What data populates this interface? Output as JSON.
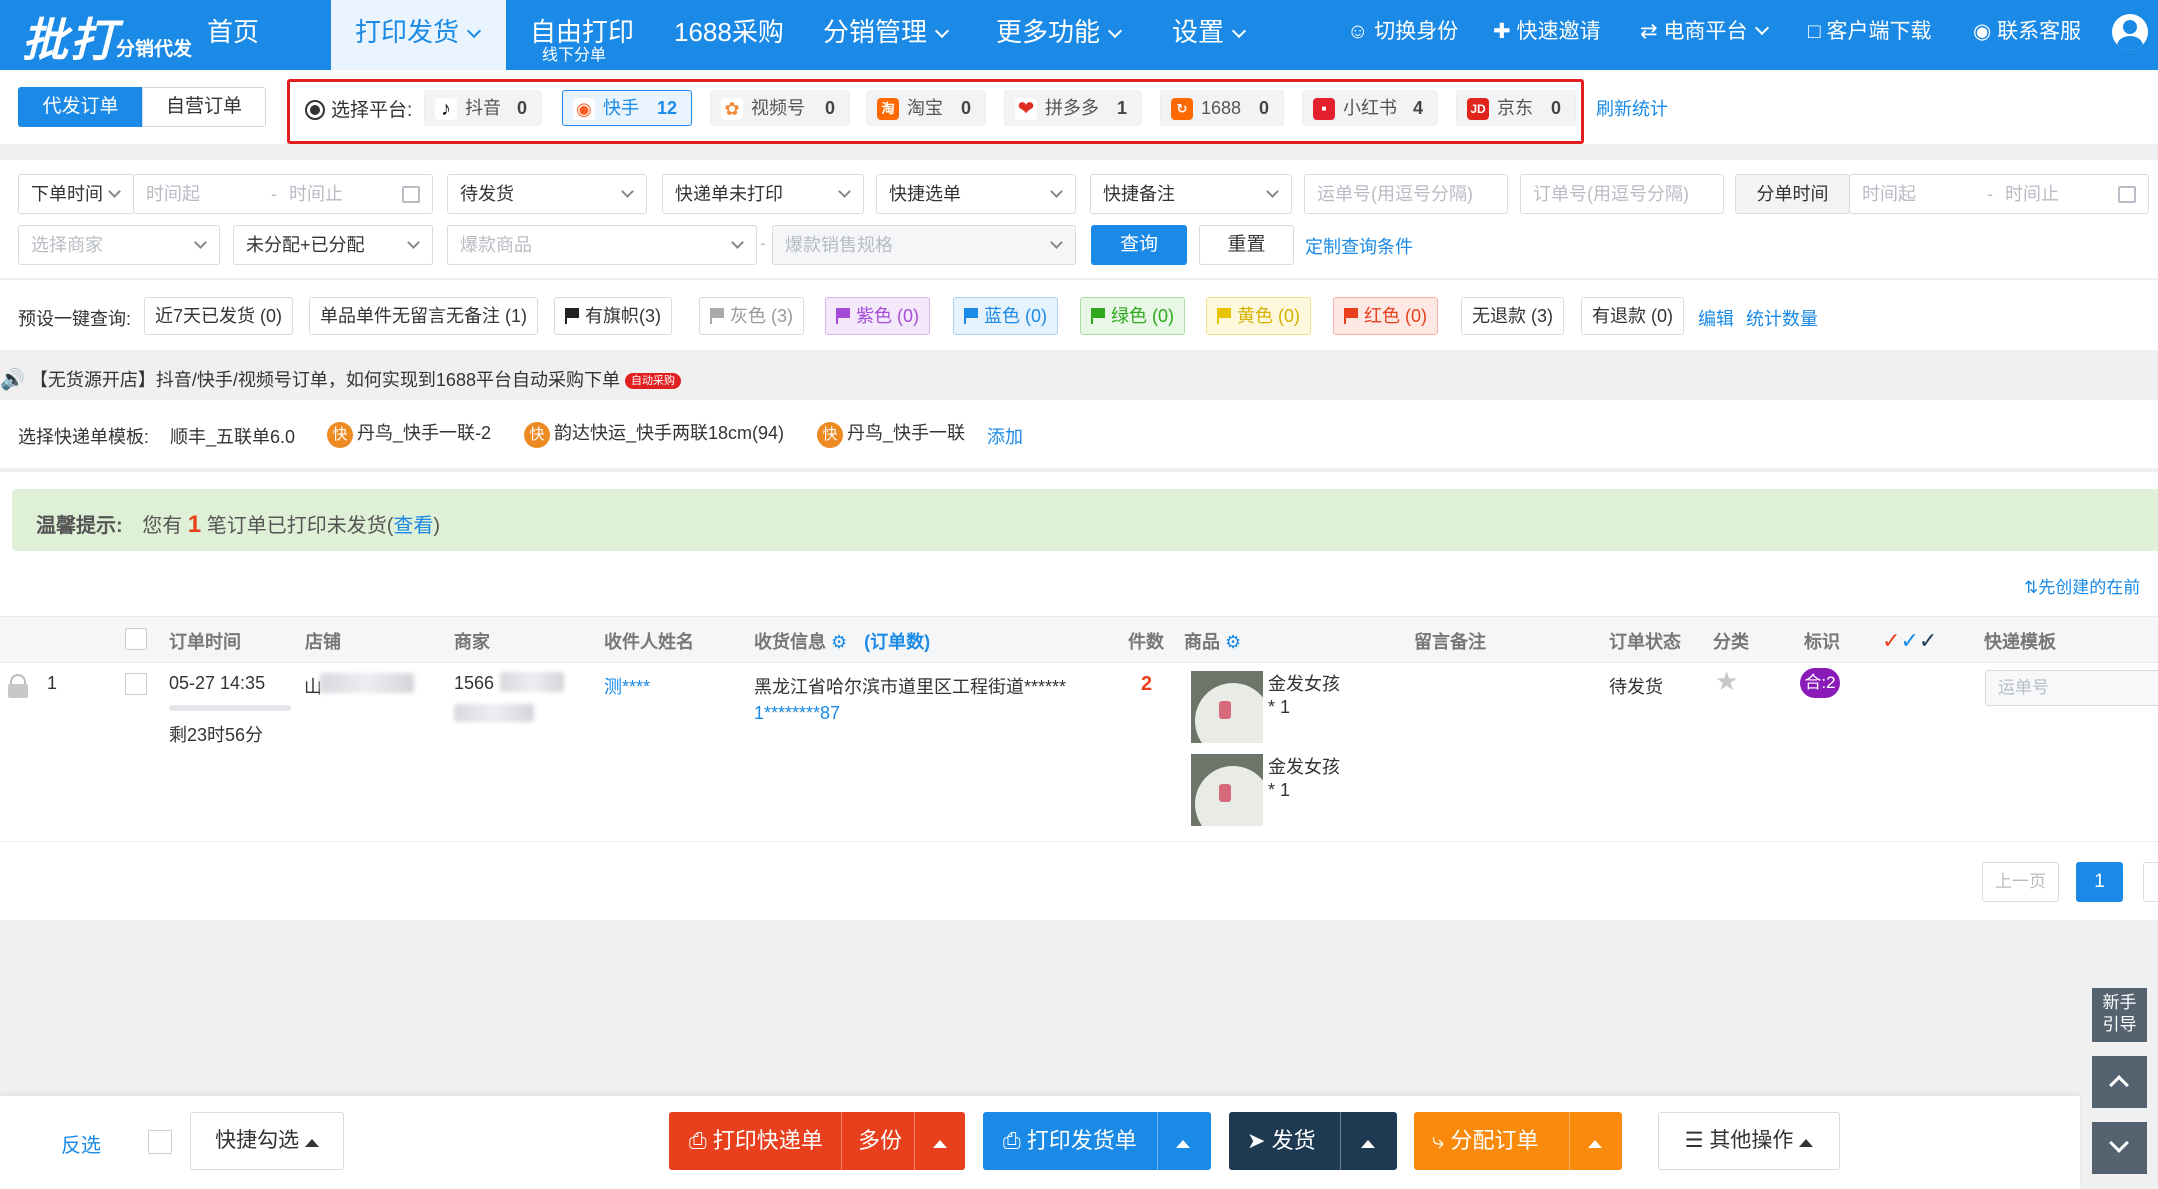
{
  "brand": {
    "logo_main": "批打",
    "logo_sub": "分销代发"
  },
  "nav": {
    "home": "首页",
    "print_ship": "打印发货",
    "free_print": "自由打印",
    "free_print_sub": "线下分单",
    "purchase_1688": "1688采购",
    "distribution": "分销管理",
    "more": "更多功能",
    "settings": "设置"
  },
  "nav_right": {
    "switch_identity": "切换身份",
    "quick_invite": "快速邀请",
    "ecommerce": "电商平台",
    "client_download": "客户端下载",
    "contact_support": "联系客服"
  },
  "order_tabs": {
    "proxy": "代发订单",
    "self": "自营订单"
  },
  "platform": {
    "label": "选择平台:",
    "items": [
      {
        "name": "抖音",
        "count": "0",
        "icon": "douyin-icon",
        "color": "#111111"
      },
      {
        "name": "快手",
        "count": "12",
        "icon": "kuaishou-icon",
        "color": "#ff5a1f"
      },
      {
        "name": "视频号",
        "count": "0",
        "icon": "shipinhao-icon",
        "color": "#f08a3c"
      },
      {
        "name": "淘宝",
        "count": "0",
        "icon": "taobao-icon",
        "color": "#ff6a00"
      },
      {
        "name": "拼多多",
        "count": "1",
        "icon": "pinduoduo-icon",
        "color": "#e02e24"
      },
      {
        "name": "1688",
        "count": "0",
        "icon": "1688-icon",
        "color": "#ff6a00"
      },
      {
        "name": "小红书",
        "count": "4",
        "icon": "xiaohongshu-icon",
        "color": "#e4202c"
      },
      {
        "name": "京东",
        "count": "0",
        "icon": "jd-icon",
        "color": "#e1251b"
      }
    ],
    "refresh": "刷新统计"
  },
  "filters": {
    "order_time": "下单时间",
    "time_start": "时间起",
    "time_end": "时间止",
    "status": "待发货",
    "express_print": "快递单未打印",
    "quick_select": "快捷选单",
    "quick_remark": "快捷备注",
    "waybill_ph": "运单号(用逗号分隔)",
    "order_no_ph": "订单号(用逗号分隔)",
    "split_time": "分单时间",
    "split_start": "时间起",
    "split_end": "时间止",
    "merchant_ph": "选择商家",
    "assign": "未分配+已分配",
    "hot_goods_ph": "爆款商品",
    "hot_spec_ph": "爆款销售规格",
    "query": "查询",
    "reset": "重置",
    "custom": "定制查询条件"
  },
  "presets": {
    "label": "预设一键查询:",
    "items": [
      {
        "label": "近7天已发货 (0)"
      },
      {
        "label": "单品单件无留言无备注 (1)"
      },
      {
        "label": "有旗帜(3)"
      },
      {
        "label": "灰色 (3)"
      },
      {
        "label": "紫色 (0)"
      },
      {
        "label": "蓝色 (0)"
      },
      {
        "label": "绿色 (0)"
      },
      {
        "label": "黄色 (0)"
      },
      {
        "label": "红色 (0)"
      },
      {
        "label": "无退款 (3)"
      },
      {
        "label": "有退款 (0)"
      }
    ],
    "edit": "编辑",
    "stat": "统计数量"
  },
  "announcement": {
    "text": "【无货源开店】抖音/快手/视频号订单，如何实现到1688平台自动采购下单",
    "badge": "自动采购"
  },
  "templates": {
    "label": "选择快递单模板:",
    "t1": "顺丰_五联单6.0",
    "t2": "丹鸟_快手一联-2",
    "t3": "韵达快运_快手两联18cm(94)",
    "t4": "丹鸟_快手一联",
    "kuai_glyph": "快",
    "add": "添加"
  },
  "notice": {
    "prefix": "温馨提示:",
    "text1": "您有",
    "count": "1",
    "text2": "笔订单已打印未发货(",
    "view": "查看",
    "text3": ")"
  },
  "sort_link": "先创建的在前",
  "table": {
    "headers": {
      "time": "订单时间",
      "shop": "店铺",
      "merchant": "商家",
      "receiver": "收件人姓名",
      "address": "收货信息",
      "order_count": "(订单数)",
      "qty": "件数",
      "goods": "商品",
      "remark": "留言备注",
      "status": "订单状态",
      "category": "分类",
      "mark": "标识",
      "template": "快递模板"
    },
    "rows": [
      {
        "index": "1",
        "time": "05-27 14:35",
        "remaining": "剩23时56分",
        "shop": "山",
        "merchant": "1566",
        "receiver": "测****",
        "address": "黑龙江省哈尔滨市道里区工程街道******",
        "phone": "1********87",
        "qty": "2",
        "goods": [
          {
            "name": "金发女孩",
            "qty": "* 1"
          },
          {
            "name": "金发女孩",
            "qty": "* 1"
          }
        ],
        "status": "待发货",
        "mark": "合:2",
        "waybill_ph": "运单号"
      }
    ]
  },
  "pagination": {
    "prev": "上一页",
    "current": "1"
  },
  "bottom": {
    "invert": "反选",
    "quick_check": "快捷勾选",
    "print_express": "打印快递单",
    "multi": "多份",
    "print_invoice": "打印发货单",
    "ship": "发货",
    "assign_order": "分配订单",
    "other": "其他操作"
  },
  "side": {
    "guide": "新手引导"
  },
  "colors": {
    "brand_blue": "#1a8ae6",
    "print_red": "#e8401c",
    "ship_dark": "#1e3a52",
    "assign_orange": "#fa8a0c",
    "merge_purple": "#8a1bb8"
  }
}
